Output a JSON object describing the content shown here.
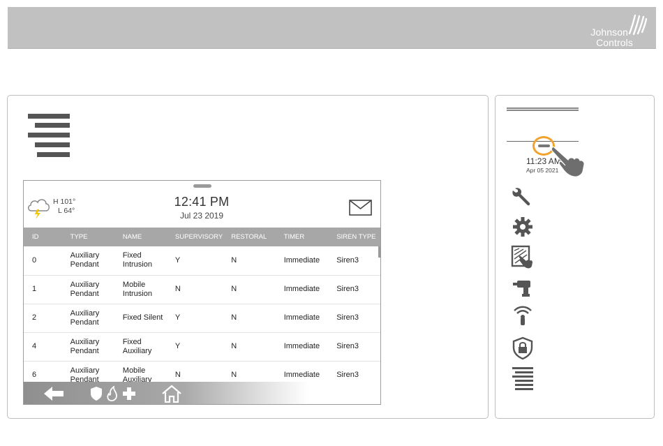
{
  "brand": {
    "line1": "Johnson",
    "line2": "Controls"
  },
  "panel": {
    "menu_icon": "menu-icon"
  },
  "screen": {
    "weather": {
      "high": "H 101°",
      "low": "L 64°",
      "icon": "storm-cloud-icon"
    },
    "clock": {
      "time": "12:41 PM",
      "date": "Jul 23 2019"
    },
    "mail_icon": "mail-icon",
    "columns": [
      "ID",
      "TYPE",
      "NAME",
      "SUPERVISORY",
      "RESTORAL",
      "TIMER",
      "SIREN TYPE"
    ],
    "rows": [
      {
        "id": "0",
        "type1": "Auxiliary",
        "type2": "Pendant",
        "name1": "Fixed",
        "name2": "Intrusion",
        "sup": "Y",
        "res": "N",
        "timer": "Immediate",
        "siren": "Siren3"
      },
      {
        "id": "1",
        "type1": "Auxiliary",
        "type2": "Pendant",
        "name1": "Mobile",
        "name2": "Intrusion",
        "sup": "N",
        "res": "N",
        "timer": "Immediate",
        "siren": "Siren3"
      },
      {
        "id": "2",
        "type1": "Auxiliary",
        "type2": "Pendant",
        "name1": "Fixed Silent",
        "name2": "",
        "sup": "Y",
        "res": "N",
        "timer": "Immediate",
        "siren": "Siren3"
      },
      {
        "id": "4",
        "type1": "Auxiliary",
        "type2": "Pendant",
        "name1": "Fixed",
        "name2": "Auxiliary",
        "sup": "Y",
        "res": "N",
        "timer": "Immediate",
        "siren": "Siren3"
      },
      {
        "id": "6",
        "type1": "Auxiliary",
        "type2": "Pendant",
        "name1": "Mobile",
        "name2": "Auxiliary",
        "sup": "N",
        "res": "N",
        "timer": "Immediate",
        "siren": "Siren3"
      }
    ],
    "bottom_icons": [
      "back-arrow-icon",
      "shield-icon",
      "fire-icon",
      "plus-icon",
      "home-icon"
    ]
  },
  "side": {
    "time": "11:23 AM",
    "date": "Apr 05 2021",
    "icons": [
      "wrench-icon",
      "gear-icon",
      "touch-panel-icon",
      "drill-icon",
      "wireless-device-icon",
      "lock-shield-icon",
      "menu-lines-icon"
    ]
  },
  "colors": {
    "accent_ring": "#f0a42d",
    "header_bg": "#c1c1c1",
    "table_header": "#a7a7a7"
  }
}
